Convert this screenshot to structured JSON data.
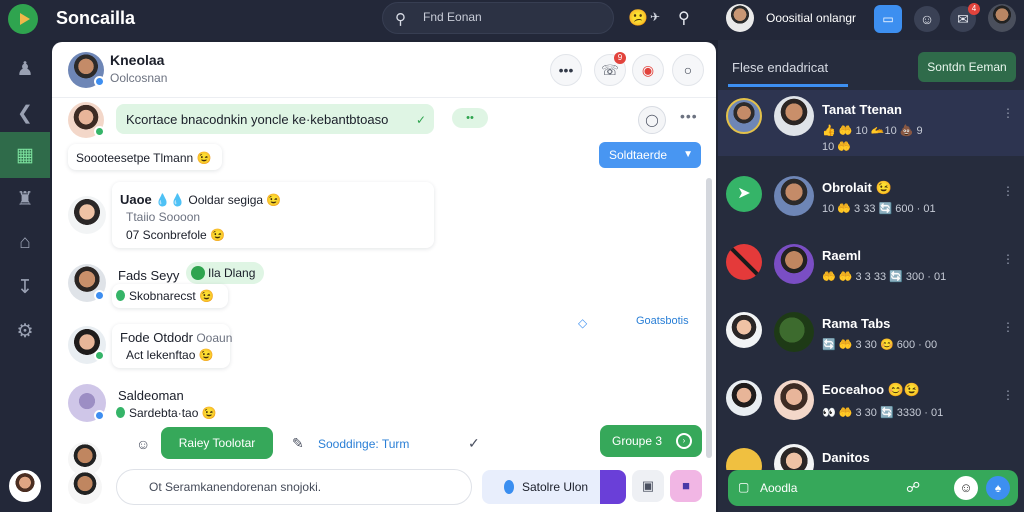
{
  "app": {
    "title": "Soncailla"
  },
  "search": {
    "placeholder": "Fnd Eonan"
  },
  "topbar": {
    "emoji": "😕",
    "emoji_extra": "✈",
    "user_name": "Ooositial onlangr",
    "blue_button": "▭",
    "badge_count": "4"
  },
  "rail": {
    "items": [
      "people",
      "back",
      "chart",
      "shirt",
      "home",
      "download",
      "settings"
    ]
  },
  "chat": {
    "header": {
      "name": "Kneolaa",
      "subtitle": "Oolcosnan",
      "badge_count": "9"
    },
    "messages": [
      {
        "text": "Kcortace bnacodnkin yoncle ke·kebantbtoaso",
        "tick": "✓"
      },
      {
        "text": "Soooteesetpe Tlmann 😉"
      },
      {
        "name": "Uaoe",
        "emoji": "💧💧",
        "extra": "Ooldar segiga 😉",
        "line2": "Ttaiio Soooon",
        "line3": "07 Sconbrefole 😉"
      },
      {
        "name": "Fads Seyy",
        "tag": "Ila Dlang",
        "line2": "Skobnarecst 😉"
      },
      {
        "name": "Fode Otdodr",
        "extra": "Ooaun",
        "line2": "Act lekenftao 😉"
      },
      {
        "name": "Saldeoman",
        "line2": "Sardebta·tao 😉"
      }
    ],
    "pill_small": "••",
    "dropdown": "Soldtaerde",
    "side_link": "Goatsbotis",
    "actions": {
      "green_button": "Raiey Toolotar",
      "link": "Sooddinge: Turm",
      "right_button": "Groupe 3"
    },
    "composer": {
      "placeholder": "Ot Seramkanendorenan snojoki.",
      "send_label": "Satolre Ulon"
    }
  },
  "right_panel": {
    "tab_label": "Flese endadricat",
    "button_label": "Sontdn Eeman",
    "rows": [
      {
        "name": "Tanat Ttenan",
        "meta1": "👍 🤲 10 🫴10 💩 9",
        "meta2": "10 🤲",
        "selected": true
      },
      {
        "name": "Obrolait 😉",
        "meta1": "10 🤲 3 33 🔄 600 · 01",
        "selected": false
      },
      {
        "name": "Raeml",
        "meta1": "🤲 🤲 3 3 33 🔄 300 · 01",
        "selected": false
      },
      {
        "name": "Rama Tabs",
        "meta1": "🔄 🤲 3 30 😊 600 · 00",
        "selected": false
      },
      {
        "name": "Eoceahoo 😊😉",
        "meta1": "👀 🤲 3 30 🔄 3330 · 01",
        "selected": false
      },
      {
        "name": "Danitos",
        "meta1": "",
        "selected": false
      }
    ],
    "composer_label": "Aoodla"
  },
  "colors": {
    "accent_green": "#36a85a",
    "accent_blue": "#3d8ff0",
    "dark_bg": "#232839",
    "badge_red": "#e2433c"
  }
}
